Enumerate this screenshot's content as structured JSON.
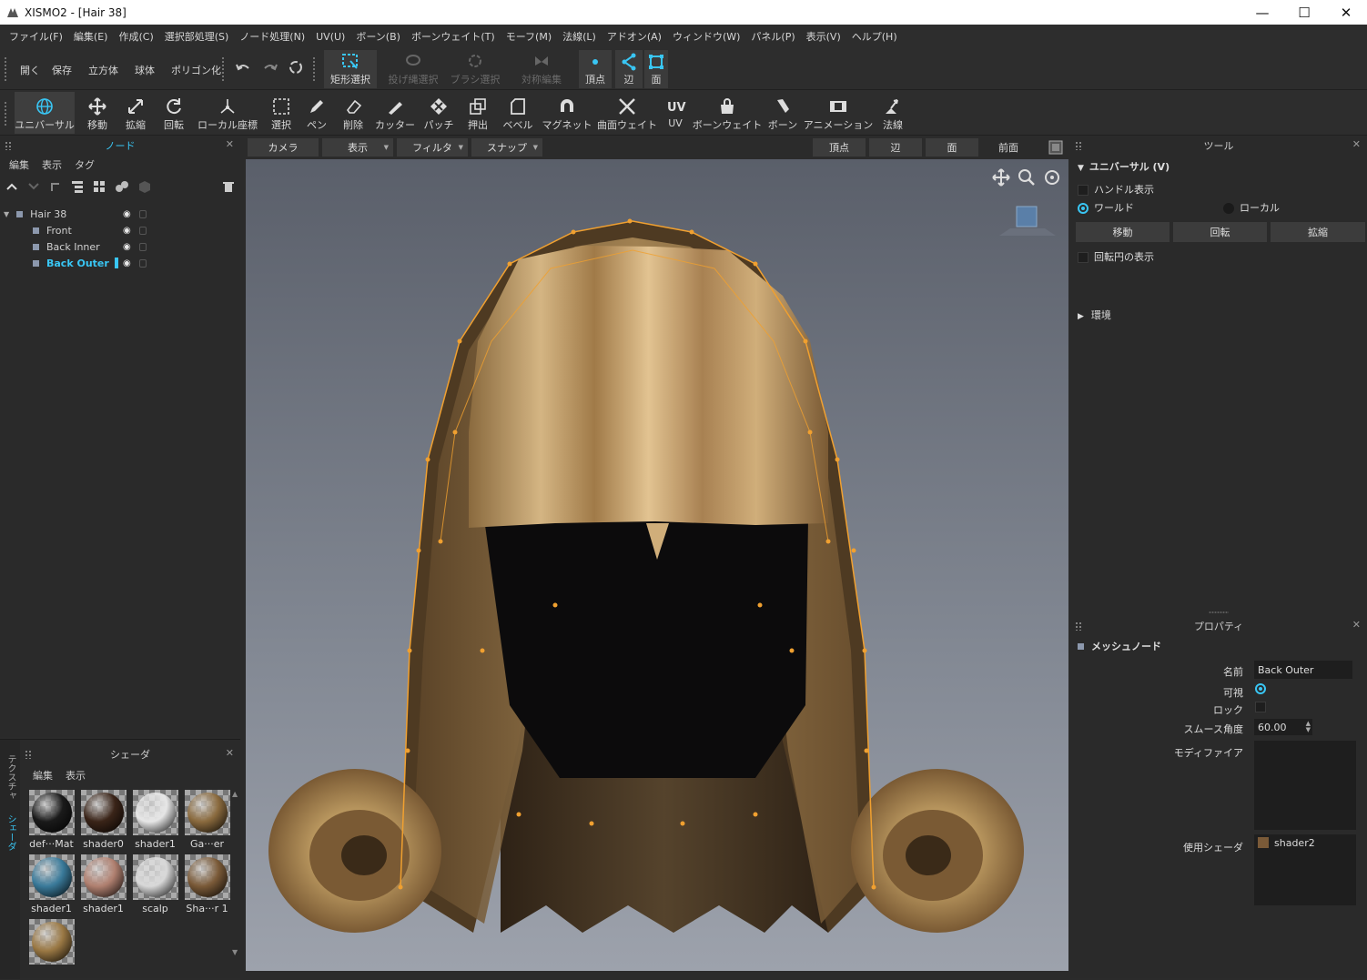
{
  "window": {
    "title": "XISMO2 - [Hair 38]",
    "controls": {
      "minimize": "—",
      "maximize": "☐",
      "close": "✕"
    }
  },
  "menubar": [
    "ファイル(F)",
    "編集(E)",
    "作成(C)",
    "選択部処理(S)",
    "ノード処理(N)",
    "UV(U)",
    "ボーン(B)",
    "ボーンウェイト(T)",
    "モーフ(M)",
    "法線(L)",
    "アドオン(A)",
    "ウィンドウ(W)",
    "パネル(P)",
    "表示(V)",
    "ヘルプ(H)"
  ],
  "toolbar1": {
    "open": "開く",
    "save": "保存",
    "cube": "立方体",
    "sphere": "球体",
    "polygonize": "ポリゴン化",
    "rect_select": "矩形選択",
    "lasso_select": "投げ縄選択",
    "brush_select": "ブラシ選択",
    "symmetry_edit": "対称編集",
    "vertex": "頂点",
    "edge": "辺",
    "face": "面"
  },
  "toolbar2": [
    "ユニバーサル",
    "移動",
    "拡縮",
    "回転",
    "ローカル座標",
    "選択",
    "ペン",
    "削除",
    "カッター",
    "パッチ",
    "押出",
    "ベベル",
    "マグネット",
    "曲面ウェイト",
    "UV",
    "ボーンウェイト",
    "ボーン",
    "アニメーション",
    "法線"
  ],
  "node_panel": {
    "title": "ノード",
    "tabs": [
      "編集",
      "表示",
      "タグ"
    ],
    "nodes": [
      {
        "label": "Hair 38",
        "level": 0
      },
      {
        "label": "Front",
        "level": 1
      },
      {
        "label": "Back Inner",
        "level": 1
      },
      {
        "label": "Back Outer",
        "level": 1,
        "selected": true
      }
    ]
  },
  "shader_panel": {
    "title": "シェーダ",
    "tabs": [
      "編集",
      "表示"
    ],
    "side_tabs": [
      "テクスチャ",
      "シェーダ"
    ],
    "shaders": [
      {
        "name": "def···Mat",
        "color": "#1a1a1a"
      },
      {
        "name": "shader0",
        "color": "#3a2418"
      },
      {
        "name": "shader1",
        "color": "#e6e6e6"
      },
      {
        "name": "Ga···er",
        "color": "#8a6a3e"
      },
      {
        "name": "shader1",
        "color": "#3a7a9a"
      },
      {
        "name": "shader1",
        "color": "#b08070"
      },
      {
        "name": "scalp",
        "color": "#d8d8d8"
      },
      {
        "name": "Sha···r 1",
        "color": "#7a5a38"
      },
      {
        "name": "",
        "color": "#9a7844"
      }
    ]
  },
  "viewport": {
    "toolbar": {
      "camera": "カメラ",
      "display": "表示",
      "filter": "フィルタ",
      "snap": "スナップ",
      "vertex": "頂点",
      "edge": "辺",
      "face": "面",
      "view": "前面"
    }
  },
  "tool_panel": {
    "title": "ツール",
    "section": "ユニバーサル (V)",
    "handle_display": "ハンドル表示",
    "world": "ワールド",
    "local": "ローカル",
    "move": "移動",
    "rotate": "回転",
    "scale": "拡縮",
    "rotation_circle": "回転円の表示",
    "environment": "環境"
  },
  "property_panel": {
    "title": "プロパティ",
    "section": "メッシュノード",
    "name_label": "名前",
    "name_value": "Back Outer",
    "visible_label": "可視",
    "lock_label": "ロック",
    "smooth_angle_label": "スムース角度",
    "smooth_angle_value": "60.00",
    "modifier_label": "モディファイア",
    "shader_used_label": "使用シェーダ",
    "shader_used_value": "shader2"
  },
  "colors": {
    "accent": "#39c6f4",
    "wire": "#f0a030"
  }
}
